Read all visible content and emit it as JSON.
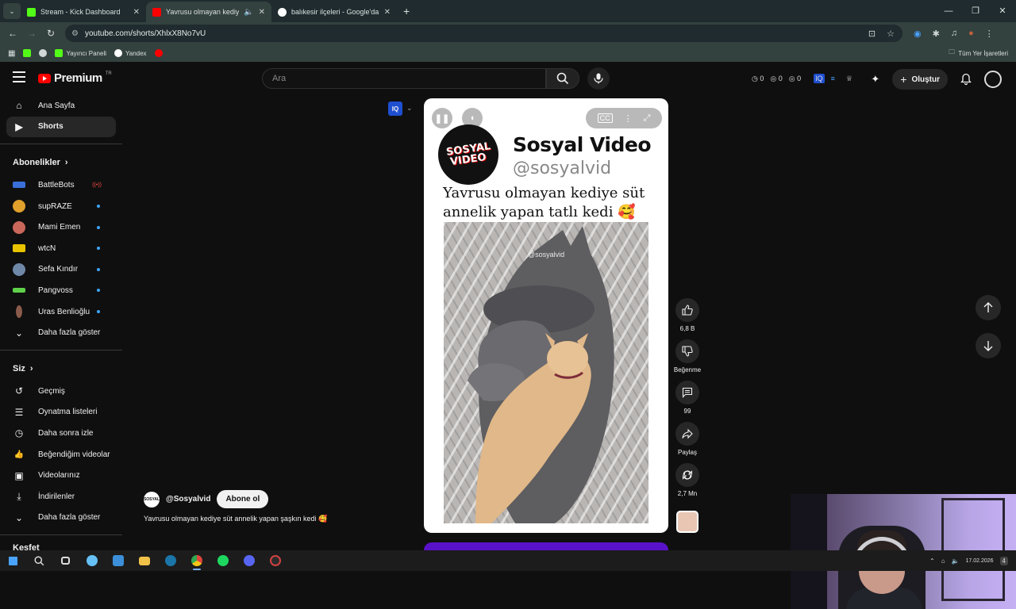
{
  "browser": {
    "tabs": [
      {
        "title": "Stream - Kick Dashboard",
        "fav_color": "#53fc18",
        "active": false
      },
      {
        "title": "Yavrusu olmayan kediye süt",
        "fav_color": "#ff0000",
        "active": true
      },
      {
        "title": "balıkesir ilçeleri - Google'da Ara",
        "fav_color": "#4285f4",
        "active": false
      }
    ],
    "new_tab_symbol": "+",
    "url": "youtube.com/shorts/XhlxX8No7vU",
    "bookmarks": [
      {
        "label": "",
        "color": "#53fc18"
      },
      {
        "label": "",
        "color": "#cfd8d6"
      },
      {
        "label": "Yayıncı Paneli",
        "color": "#53fc18"
      },
      {
        "label": "Yandex",
        "color": "#ffffff"
      },
      {
        "label": "",
        "color": "#ff0000"
      }
    ],
    "all_bookmarks": "Tüm Yer İşaretleri"
  },
  "masthead": {
    "logo_text": "Premium",
    "logo_sup": "TR",
    "search_placeholder": "Ara",
    "stats": [
      "0",
      "0",
      "0"
    ],
    "create_label": "Oluştur"
  },
  "sidebar": {
    "top": [
      {
        "label": "Ana Sayfa",
        "icon": "home-icon",
        "glyph": "⌂"
      },
      {
        "label": "Shorts",
        "icon": "shorts-icon",
        "glyph": "▶",
        "selected": true
      }
    ],
    "subscriptions_title": "Abonelikler",
    "subscriptions": [
      {
        "label": "BattleBots",
        "color": "#3a6fd8",
        "status": "live"
      },
      {
        "label": "supRAZE",
        "color": "#e1a02c",
        "status": "dot"
      },
      {
        "label": "Mami Emen",
        "color": "#c9675b",
        "status": "dot"
      },
      {
        "label": "wtcN",
        "color": "#e8c400",
        "status": "dot"
      },
      {
        "label": "Sefa Kındır",
        "color": "#6f88a8",
        "status": "dot"
      },
      {
        "label": "Pangvoss",
        "color": "#5fd14a",
        "status": "dot"
      },
      {
        "label": "Uras Benlioğlu",
        "color": "#8a5b4b",
        "status": "dot"
      }
    ],
    "show_more": "Daha fazla göster",
    "you_title": "Siz",
    "you_items": [
      {
        "label": "Geçmiş",
        "icon": "history-icon",
        "glyph": "↺"
      },
      {
        "label": "Oynatma listeleri",
        "icon": "playlists-icon",
        "glyph": "☰"
      },
      {
        "label": "Daha sonra izle",
        "icon": "watch-later-icon",
        "glyph": "◷"
      },
      {
        "label": "Beğendiğim videolar",
        "icon": "liked-icon",
        "glyph": "👍"
      },
      {
        "label": "Videolarınız",
        "icon": "your-videos-icon",
        "glyph": "▣"
      },
      {
        "label": "İndirilenler",
        "icon": "downloads-icon",
        "glyph": "⤓"
      }
    ],
    "show_more_2": "Daha fazla göster",
    "explore_title": "Keşfet"
  },
  "short": {
    "channel_name": "Sosyal Video",
    "channel_handle": "@sosyalvid",
    "logo_text_1": "SOSYAL",
    "logo_text_2": "VIDEO",
    "caption": "Yavrusu olmayan kediye süt annelik yapan tatlı kedi 🥰",
    "watermark": "@sosyalvid"
  },
  "actions": {
    "likes": "6,8 B",
    "dislike": "Beğenme",
    "comments": "99",
    "share": "Paylaş",
    "remix": "2,7 Mn"
  },
  "meta": {
    "handle": "@Sosyalvid",
    "subscribe": "Abone ol",
    "title": "Yavrusu olmayan kediye süt annelik yapan şaşkın kedi 🥰",
    "avatar_text": "SOSYAL"
  },
  "taskbar": {
    "apps": [
      {
        "name": "windows-start-icon",
        "color": "#4aa3ff"
      },
      {
        "name": "search-icon",
        "color": "#dddddd"
      },
      {
        "name": "task-view-icon",
        "color": "#dddddd"
      },
      {
        "name": "steam-icon",
        "color": "#66c0f4"
      },
      {
        "name": "store-icon",
        "color": "#3c8fd8"
      },
      {
        "name": "explorer-icon",
        "color": "#f0c24a"
      },
      {
        "name": "steam-icon-2",
        "color": "#1b75a8"
      },
      {
        "name": "chrome-icon",
        "color": "#e2443a"
      },
      {
        "name": "spotify-icon",
        "color": "#1ed760"
      },
      {
        "name": "discord-icon",
        "color": "#5865f2"
      },
      {
        "name": "obs-icon",
        "color": "#d24141"
      }
    ],
    "date": "17.02.2026",
    "notif_count": "4"
  }
}
